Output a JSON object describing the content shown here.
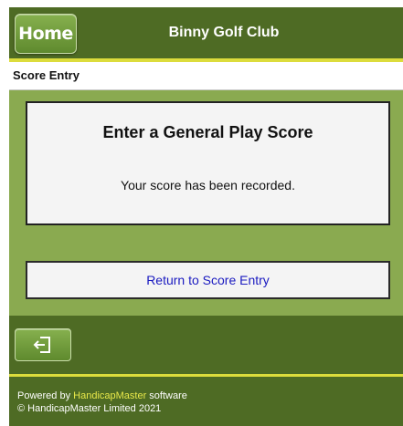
{
  "header": {
    "home_label": "Home",
    "title": "Binny Golf Club"
  },
  "section": {
    "title": "Score Entry"
  },
  "panel": {
    "heading": "Enter a General Play Score",
    "message": "Your score has been recorded."
  },
  "actions": {
    "return_label": "Return to Score Entry"
  },
  "footer": {
    "exit_icon": "logout-icon",
    "powered_prefix": "Powered by ",
    "brand": "HandicapMaster",
    "powered_suffix": " software",
    "copyright": "© HandicapMaster Limited 2021"
  },
  "colors": {
    "header_bg": "#4e6b24",
    "page_bg": "#8aaa50",
    "accent_line": "#dcdc3c",
    "link_blue": "#1a1ac0",
    "brand_yellow": "#e8e84a"
  }
}
